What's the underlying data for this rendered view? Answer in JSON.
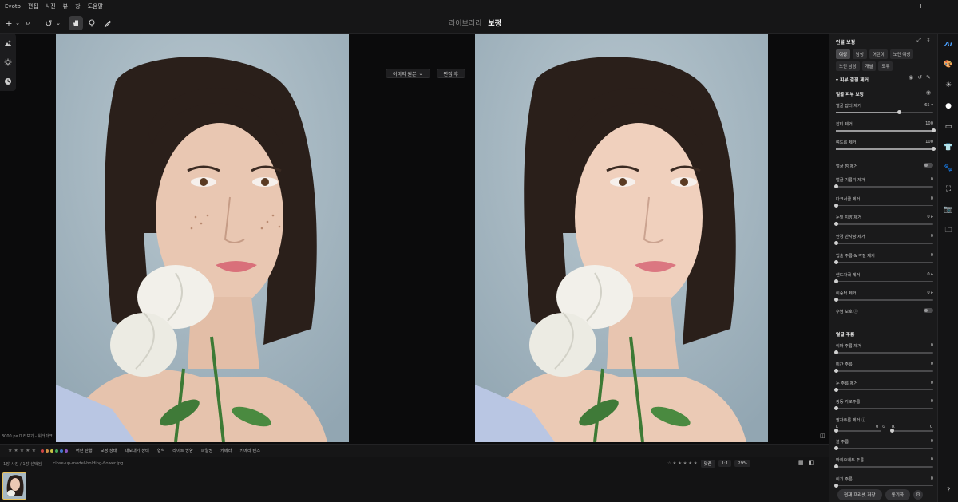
{
  "app": {
    "name": "Evoto"
  },
  "menu": [
    "편집",
    "사진",
    "뷰",
    "창",
    "도움말"
  ],
  "modes": {
    "library": "라이브러리",
    "edit": "보정"
  },
  "toolbar": {
    "plus": "+",
    "search_icon": "⌕",
    "undo_icon": "↺"
  },
  "viewer": {
    "before_select": "이미지 원본",
    "after_label": "편집 후",
    "preview_caption": "3000 px 미리보기 - 워터마크 ..."
  },
  "actionbar": {
    "items": [
      "어떤 관행",
      "보정 상태",
      "내보내기 상태",
      "형식",
      "라이트 방향",
      "파일명",
      "카메라",
      "카메라 렌즈"
    ],
    "label_colors": [
      "#d04545",
      "#d09045",
      "#c9c245",
      "#45a85a",
      "#4575d0",
      "#8a55c0"
    ]
  },
  "thumbs": {
    "count_text": "1장 사진 / 1장 선택됨",
    "filename": "close-up-model-holding-flower.jpg"
  },
  "zoom": {
    "fit": "맞춤",
    "ratio": "1:1",
    "percent": "29%"
  },
  "panel": {
    "title": "인물 보정",
    "chips": [
      "여성",
      "남성",
      "어린이",
      "노인 여성",
      "노인 남성",
      "개별",
      "모두"
    ],
    "chip_selected": "여성",
    "section1": "피부 결점 제거",
    "sub1": "얼굴 피부 보정",
    "sliders1": [
      {
        "label": "얼굴 잡티 제거",
        "value": "65",
        "level": 0.65
      },
      {
        "label": "잡티 제거",
        "value": "100",
        "level": 1.0
      },
      {
        "label": "여드름 제거",
        "value": "100",
        "level": 1.0
      }
    ],
    "toggle_face_mole": "얼굴 점 제거",
    "sliders2": [
      {
        "label": "얼굴 기름기 제거",
        "value": "0",
        "level": 0
      },
      {
        "label": "다크서클 제거",
        "value": "0",
        "level": 0
      },
      {
        "label": "눈밑 지방 제거",
        "value": "0",
        "level": 0
      },
      {
        "label": "안경 반사광 제거",
        "value": "0",
        "level": 0
      },
      {
        "label": "입술 주름 & 각질 제거",
        "value": "0",
        "level": 0
      },
      {
        "label": "렌드자국 제거",
        "value": "0",
        "level": 0
      },
      {
        "label": "이중턱 제거",
        "value": "0",
        "level": 0
      }
    ],
    "toggle_beard": "수염 보호",
    "section2": "얼굴 주름",
    "sliders3": [
      {
        "label": "이마 주름 제거",
        "value": "0",
        "level": 0
      },
      {
        "label": "미간 주름",
        "value": "0",
        "level": 0
      },
      {
        "label": "눈 주름 제거",
        "value": "0",
        "level": 0
      },
      {
        "label": "광동 가로주름",
        "value": "0",
        "level": 0
      }
    ],
    "nasolabial": {
      "label": "팔자주름 제거",
      "l": "L",
      "r": "R",
      "l_val": "0",
      "r_val": "0"
    },
    "sliders4": [
      {
        "label": "볼 주름",
        "value": "0",
        "level": 0
      },
      {
        "label": "마리오네트 주름",
        "value": "0",
        "level": 0
      },
      {
        "label": "이기 주름",
        "value": "0",
        "level": 0
      }
    ],
    "footer_save": "현재 프리셋 저장",
    "footer_sync": "동기화"
  }
}
